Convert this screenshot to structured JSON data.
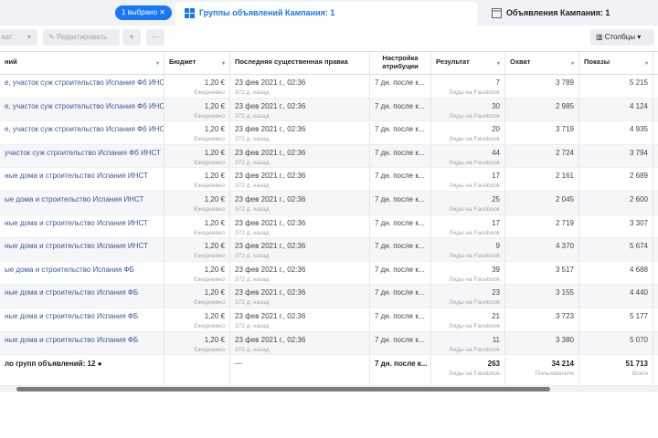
{
  "selection_badge": "1 выбрано",
  "tabs": {
    "ad_groups": "Группы объявлений Кампания: 1",
    "ads": "Объявления Кампания: 1"
  },
  "toolbar": {
    "left_btn": "кат",
    "edit": "Редактировать",
    "more": "···",
    "columns": "Столбцы"
  },
  "columns": [
    "ний",
    "Бюджет",
    "Последняя существенная правка",
    "Настройка атрибуции",
    "Результат",
    "Охват",
    "Показы"
  ],
  "rows": [
    {
      "name": "е, участок суж строительство Испания Фб ИНСТ",
      "budget": "1,20 €",
      "budget_sub": "Ежедневно",
      "date": "23 фев 2021 г., 02:36",
      "date_sub": "372 д. назад",
      "attr": "7 дн. после к...",
      "result": "7",
      "result_sub": "Лиды на Facebook",
      "reach": "3 789",
      "shows": "5 215"
    },
    {
      "name": "е, участок суж строительство Испания Фб ИНСТ",
      "budget": "1,20 €",
      "budget_sub": "Ежедневно",
      "date": "23 фев 2021 г., 02:36",
      "date_sub": "372 д. назад",
      "attr": "7 дн. после к...",
      "result": "30",
      "result_sub": "Лиды на Facebook",
      "reach": "2 985",
      "shows": "4 124"
    },
    {
      "name": "е, участок суж строительство Испания Фб ИНСТ",
      "budget": "1,20 €",
      "budget_sub": "Ежедневно",
      "date": "23 фев 2021 г., 02:36",
      "date_sub": "372 д. назад",
      "attr": "7 дн. после к...",
      "result": "20",
      "result_sub": "Лиды на Facebook",
      "reach": "3 719",
      "shows": "4 935"
    },
    {
      "name": "участок суж строительство Испания Фб ИНСТ",
      "budget": "1,20 €",
      "budget_sub": "Ежедневно",
      "date": "23 фев 2021 г., 02:36",
      "date_sub": "372 д. назад",
      "attr": "7 дн. после к...",
      "result": "44",
      "result_sub": "Лиды на Facebook",
      "reach": "2 724",
      "shows": "3 794"
    },
    {
      "name": "ные дома и строительство Испания ИНСТ",
      "budget": "1,20 €",
      "budget_sub": "Ежедневно",
      "date": "23 фев 2021 г., 02:36",
      "date_sub": "372 д. назад",
      "attr": "7 дн. после к...",
      "result": "17",
      "result_sub": "Лиды на Facebook",
      "reach": "2 161",
      "shows": "2 689"
    },
    {
      "name": "ые дома и строительство Испания ИНСТ",
      "budget": "1,20 €",
      "budget_sub": "Ежедневно",
      "date": "23 фев 2021 г., 02:36",
      "date_sub": "372 д. назад",
      "attr": "7 дн. после к...",
      "result": "25",
      "result_sub": "Лиды на Facebook",
      "reach": "2 045",
      "shows": "2 600"
    },
    {
      "name": "ные дома и строительство Испания ИНСТ",
      "budget": "1,20 €",
      "budget_sub": "Ежедневно",
      "date": "23 фев 2021 г., 02:36",
      "date_sub": "372 д. назад",
      "attr": "7 дн. после к...",
      "result": "17",
      "result_sub": "Лиды на Facebook",
      "reach": "2 719",
      "shows": "3 307"
    },
    {
      "name": "ные дома и строительство Испания ИНСТ",
      "budget": "1,20 €",
      "budget_sub": "Ежедневно",
      "date": "23 фев 2021 г., 02:36",
      "date_sub": "372 д. назад",
      "attr": "7 дн. после к...",
      "result": "9",
      "result_sub": "Лиды на Facebook",
      "reach": "4 370",
      "shows": "5 674"
    },
    {
      "name": "ые дома и строительство Испания ФБ",
      "budget": "1,20 €",
      "budget_sub": "Ежедневно",
      "date": "23 фев 2021 г., 02:36",
      "date_sub": "372 д. назад",
      "attr": "7 дн. после к...",
      "result": "39",
      "result_sub": "Лиды на Facebook",
      "reach": "3 517",
      "shows": "4 688"
    },
    {
      "name": "ные дома и строительство Испания ФБ",
      "budget": "1,20 €",
      "budget_sub": "Ежедневно",
      "date": "23 фев 2021 г., 02:36",
      "date_sub": "372 д. назад",
      "attr": "7 дн. после к...",
      "result": "23",
      "result_sub": "Лиды на Facebook",
      "reach": "3 155",
      "shows": "4 440"
    },
    {
      "name": "ные дома и строительство Испания ФБ",
      "budget": "1,20 €",
      "budget_sub": "Ежедневно",
      "date": "23 фев 2021 г., 02:36",
      "date_sub": "372 д. назад",
      "attr": "7 дн. после к...",
      "result": "21",
      "result_sub": "Лиды на Facebook",
      "reach": "3 723",
      "shows": "5 177"
    },
    {
      "name": "ные дома и строительство Испания ФБ",
      "budget": "1,20 €",
      "budget_sub": "Ежедневно",
      "date": "23 фев 2021 г., 02:36",
      "date_sub": "372 д. назад",
      "attr": "7 дн. после к...",
      "result": "11",
      "result_sub": "Лиды на Facebook",
      "reach": "3 380",
      "shows": "5 070"
    }
  ],
  "total": {
    "name": "ло групп объявлений: 12",
    "date": "—",
    "attr": "7 дн. после к...",
    "result": "263",
    "result_sub": "Лиды на Facebook",
    "reach": "34 214",
    "reach_sub": "Пользователи",
    "shows": "51 713",
    "shows_sub": "Всего"
  }
}
